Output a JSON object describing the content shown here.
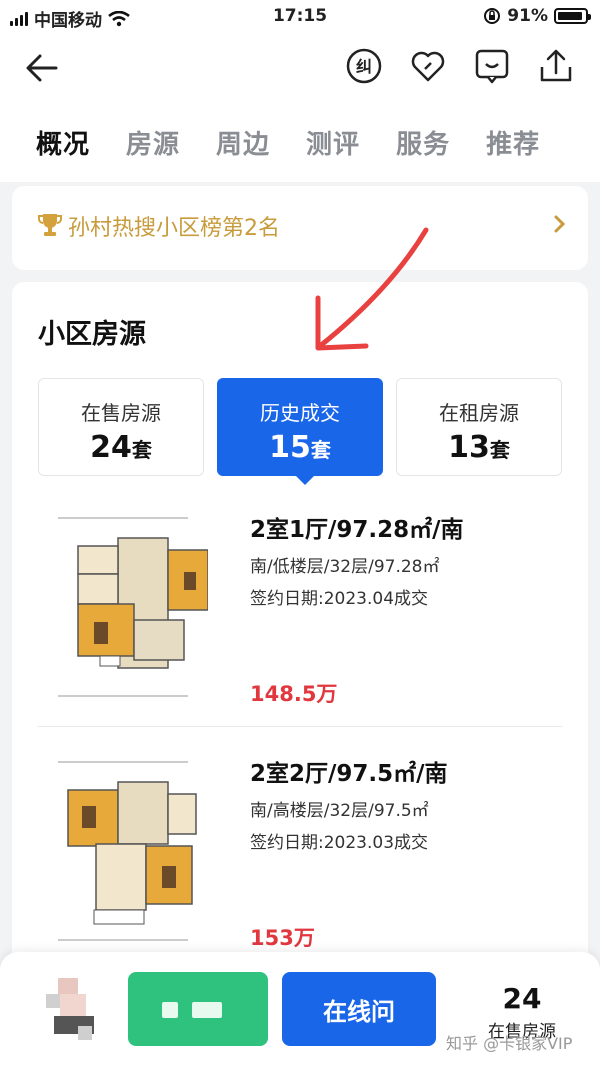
{
  "status": {
    "carrier": "中国移动",
    "time": "17:15",
    "battery": "91%",
    "battery_level": 0.91
  },
  "nav": {
    "icons": [
      "back-arrow-icon",
      "correction-icon",
      "heart-icon",
      "message-icon",
      "share-icon"
    ],
    "correction_glyph": "纠"
  },
  "tabs": [
    "概况",
    "房源",
    "周边",
    "测评",
    "服务",
    "推荐"
  ],
  "rank": {
    "text": "孙村热搜小区榜第2名"
  },
  "section": {
    "title": "小区房源"
  },
  "segments": [
    {
      "label": "在售房源",
      "count": "24",
      "unit": "套"
    },
    {
      "label": "历史成交",
      "count": "15",
      "unit": "套"
    },
    {
      "label": "在租房源",
      "count": "13",
      "unit": "套"
    }
  ],
  "listings": [
    {
      "title": "2室1厅/97.28㎡/南",
      "meta": "南/低楼层/32层/97.28㎡",
      "sign": "签约日期:2023.04成交",
      "price": "148.5万"
    },
    {
      "title": "2室2厅/97.5㎡/南",
      "meta": "南/高楼层/32层/97.5㎡",
      "sign": "签约日期:2023.03成交",
      "price": "153万"
    }
  ],
  "bottom": {
    "online_label": "在线问",
    "onsale_count": "24",
    "onsale_label": "在售房源"
  },
  "watermark": "知乎 @卡银家VIP",
  "colors": {
    "accent": "#1a66e8",
    "price": "#e0383e",
    "gold": "#c89b3c",
    "green": "#2ec27e",
    "annotation": "#e8413f"
  }
}
